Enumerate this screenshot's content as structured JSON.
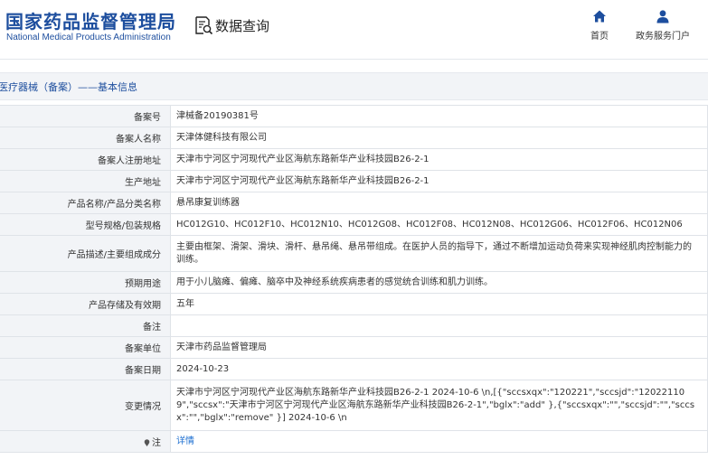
{
  "header": {
    "logo_cn": "国家药品监督管理局",
    "logo_en": "National Medical Products Administration",
    "query_label": "数据查询",
    "nav": [
      {
        "label": "首页",
        "icon": "home-icon"
      },
      {
        "label": "政务服务门户",
        "icon": "user-icon"
      }
    ]
  },
  "section_title": "医疗器械（备案）——基本信息",
  "detail_rows": [
    {
      "key": "备案号",
      "value": "津械备20190381号"
    },
    {
      "key": "备案人名称",
      "value": "天津体健科技有限公司"
    },
    {
      "key": "备案人注册地址",
      "value": "天津市宁河区宁河现代产业区海航东路新华产业科技园B26-2-1"
    },
    {
      "key": "生产地址",
      "value": "天津市宁河区宁河现代产业区海航东路新华产业科技园B26-2-1"
    },
    {
      "key": "产品名称/产品分类名称",
      "value": "悬吊康复训练器"
    },
    {
      "key": "型号规格/包装规格",
      "value": "HC012G10、HC012F10、HC012N10、HC012G08、HC012F08、HC012N08、HC012G06、HC012F06、HC012N06"
    },
    {
      "key": "产品描述/主要组成成分",
      "value": "主要由框架、滑架、滑块、滑杆、悬吊绳、悬吊带组成。在医护人员的指导下，通过不断增加运动负荷来实现神经肌肉控制能力的训练。"
    },
    {
      "key": "预期用途",
      "value": "用于小儿脑瘫、偏瘫、脑卒中及神经系统疾病患者的感觉统合训练和肌力训练。"
    },
    {
      "key": "产品存储及有效期",
      "value": "五年"
    },
    {
      "key": "备注",
      "value": ""
    },
    {
      "key": "备案单位",
      "value": "天津市药品监督管理局"
    },
    {
      "key": "备案日期",
      "value": "2024-10-23"
    },
    {
      "key": "变更情况",
      "value": "天津市宁河区宁河现代产业区海航东路新华产业科技园B26-2-1 2024-10-6 \\n,[{\"sccsxqx\":\"120221\",\"sccsjd\":\"120221109\",\"sccsx\":\"天津市宁河区宁河现代产业区海航东路新华产业科技园B26-2-1\",\"bglx\":\"add\" },{\"sccsxqx\":\"\",\"sccsjd\":\"\",\"sccsx\":\"\",\"bglx\":\"remove\" }] 2024-10-6 \\n"
    },
    {
      "key": "注",
      "value": "详情"
    }
  ]
}
